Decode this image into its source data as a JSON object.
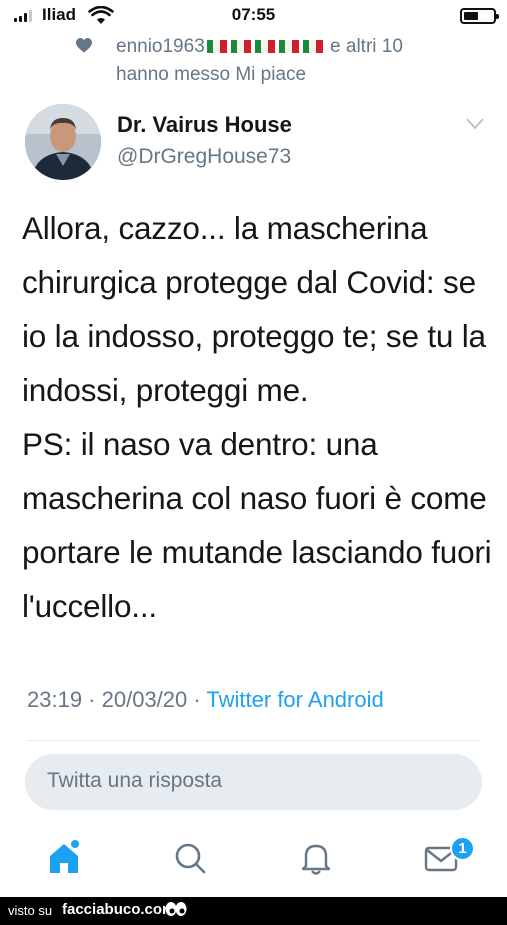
{
  "status_bar": {
    "carrier": "Iliad",
    "time": "07:55"
  },
  "liked_by": {
    "user": "ennio1963",
    "suffix": "e altri 10",
    "line2": "hanno messo Mi piace",
    "flag_count": 5
  },
  "author": {
    "name": "Dr. Vairus House",
    "handle": "@DrGregHouse73"
  },
  "tweet": {
    "paragraph1": "Allora, cazzo... la mascherina chirurgica protegge dal Covid: se io la indosso, proteggo te; se tu la indossi, proteggi me.",
    "paragraph2": "PS: il naso va dentro: una mascherina col naso fuori è come portare le mutande lasciando fuori l'uccello...",
    "time": "23:19",
    "date": "20/03/20",
    "source": "Twitter for Android"
  },
  "reply": {
    "placeholder": "Twitta una risposta"
  },
  "tab_bar": {
    "messages_badge": "1"
  },
  "watermark": {
    "prefix": "visto su",
    "site": "facciabuco.com"
  },
  "colors": {
    "accent": "#1da1f2",
    "secondary_text": "#657786",
    "reply_bg": "#e6ecf0"
  }
}
